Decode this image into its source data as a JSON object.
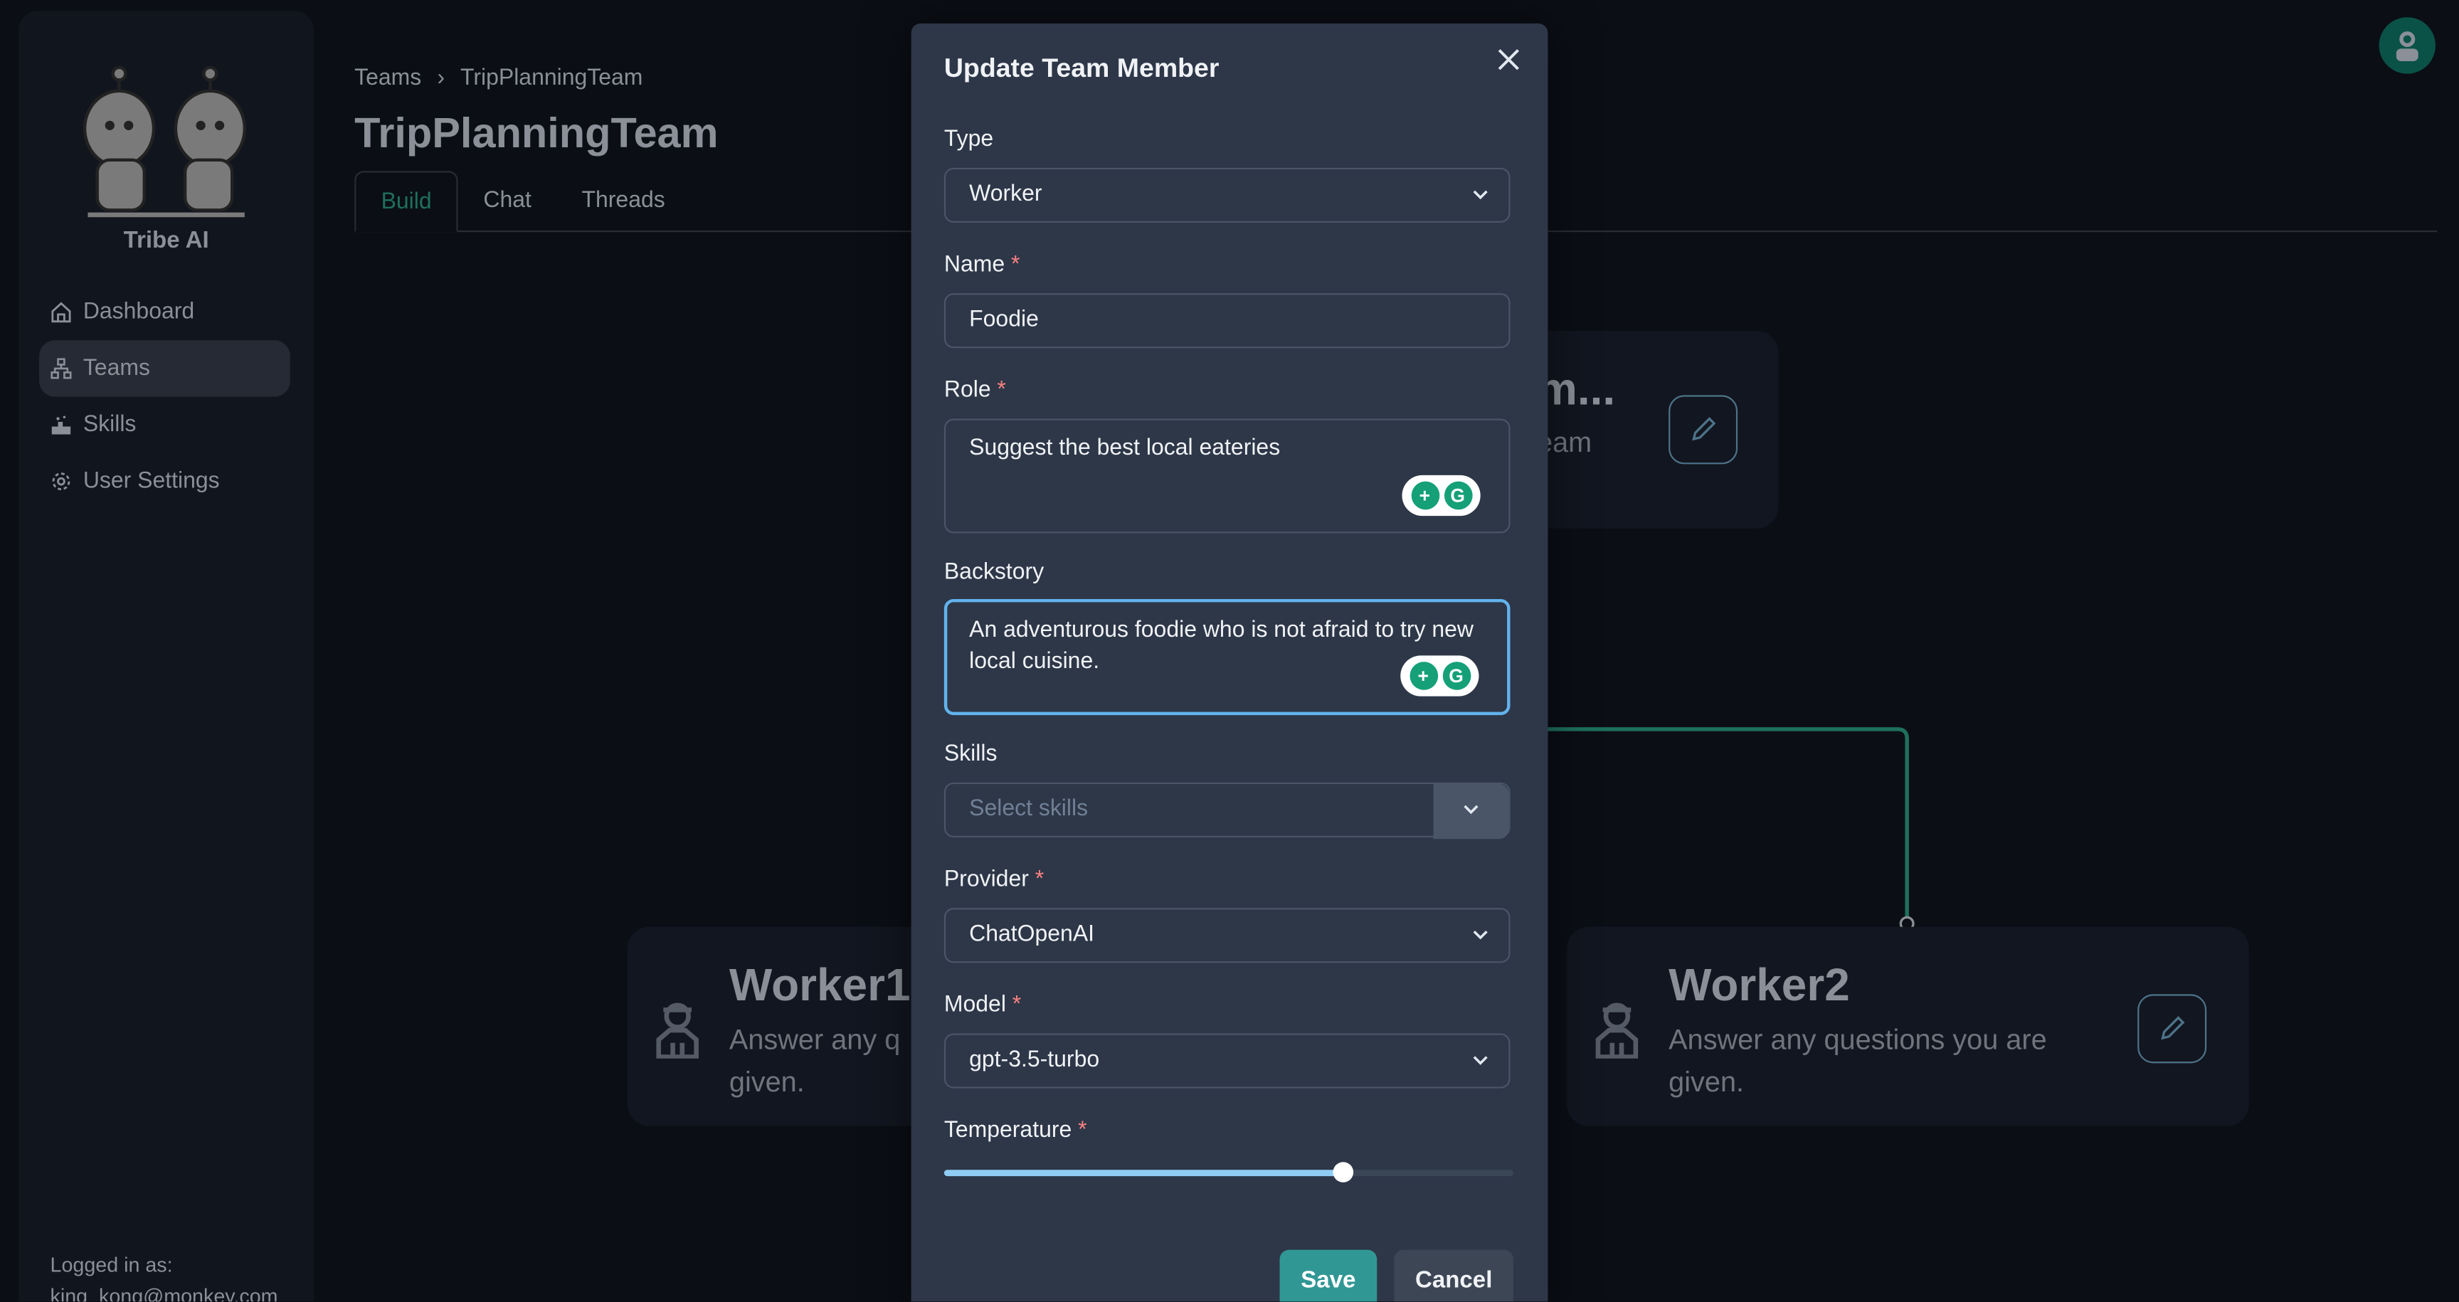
{
  "sidebar": {
    "brand": "Tribe AI",
    "items": [
      {
        "label": "Dashboard",
        "icon": "home-icon"
      },
      {
        "label": "Teams",
        "icon": "hierarchy-icon",
        "active": true
      },
      {
        "label": "Skills",
        "icon": "skills-icon"
      },
      {
        "label": "User Settings",
        "icon": "gear-icon"
      }
    ],
    "logged_in_label": "Logged in as:",
    "user_email": "king_kong@monkey.com"
  },
  "breadcrumb": {
    "root": "Teams",
    "separator": "›",
    "current": "TripPlanningTeam"
  },
  "page_title": "TripPlanningTeam",
  "tabs": [
    {
      "label": "Build",
      "active": true
    },
    {
      "label": "Chat"
    },
    {
      "label": "Threads"
    }
  ],
  "canvas": {
    "leader": {
      "title_fragment": "m...",
      "desc_fragment": "eam"
    },
    "worker1": {
      "title": "Worker1",
      "desc": "Answer any q",
      "desc2": "given."
    },
    "worker2": {
      "title": "Worker2",
      "desc": "Answer any questions you are",
      "desc2": "given."
    },
    "edge_color": "#1f6f5e"
  },
  "modal": {
    "title": "Update Team Member",
    "type": {
      "label": "Type",
      "value": "Worker"
    },
    "name": {
      "label": "Name",
      "value": "Foodie"
    },
    "role": {
      "label": "Role",
      "value": "Suggest the best local eateries"
    },
    "backstory": {
      "label": "Backstory",
      "value": "An adventurous foodie who is not afraid to try new local cuisine."
    },
    "skills": {
      "label": "Skills",
      "placeholder": "Select skills"
    },
    "provider": {
      "label": "Provider",
      "value": "ChatOpenAI"
    },
    "model": {
      "label": "Model",
      "value": "gpt-3.5-turbo"
    },
    "temperature": {
      "label": "Temperature",
      "value_fraction": 0.7
    },
    "required_mark": "*",
    "save_label": "Save",
    "cancel_label": "Cancel",
    "colors": {
      "accent": "#319795",
      "focus": "#63b3ed",
      "slider": "#90cdf4"
    }
  }
}
